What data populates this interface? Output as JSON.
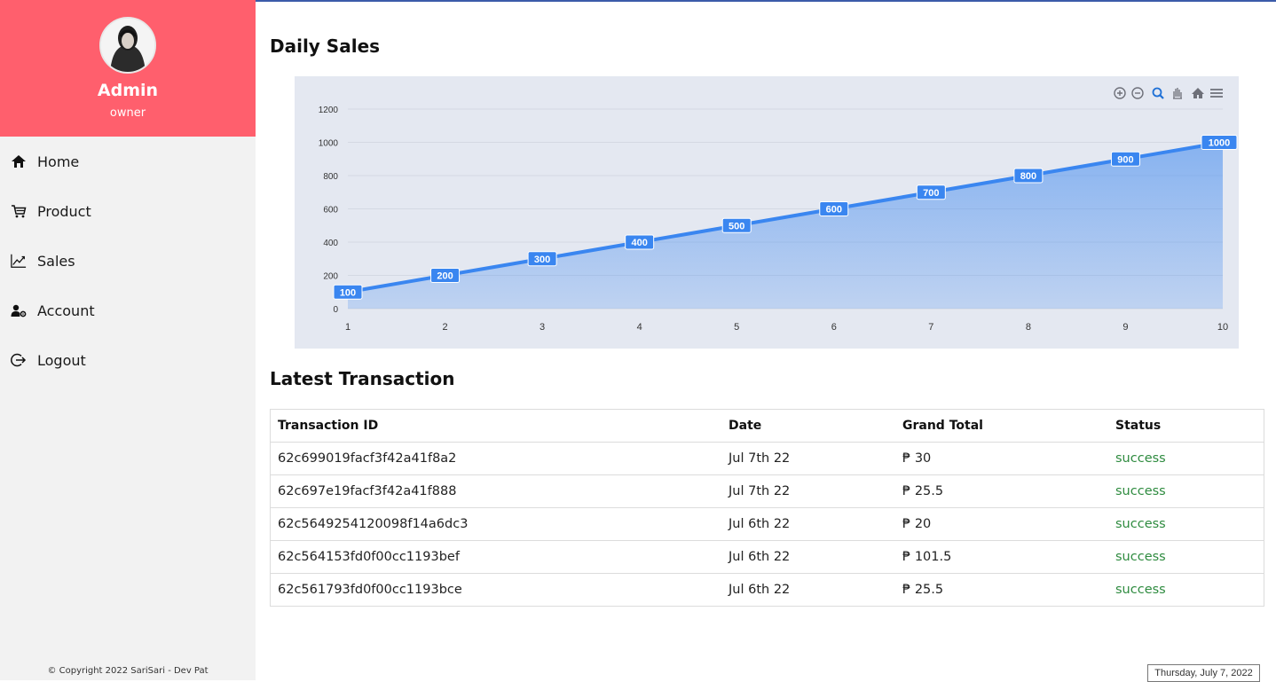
{
  "user": {
    "name": "Admin",
    "role": "owner"
  },
  "nav": [
    {
      "label": "Home",
      "icon": "home-icon"
    },
    {
      "label": "Product",
      "icon": "cart-icon"
    },
    {
      "label": "Sales",
      "icon": "chart-line-icon"
    },
    {
      "label": "Account",
      "icon": "user-gear-icon"
    },
    {
      "label": "Logout",
      "icon": "logout-icon"
    }
  ],
  "footer": {
    "copyright": "© Copyright 2022 SariSari - Dev Pat"
  },
  "daily_sales": {
    "title": "Daily Sales"
  },
  "chart_data": {
    "type": "area",
    "title": "",
    "xlabel": "",
    "ylabel": "",
    "x": [
      1,
      2,
      3,
      4,
      5,
      6,
      7,
      8,
      9,
      10
    ],
    "series": [
      {
        "values": [
          100,
          200,
          300,
          400,
          500,
          600,
          700,
          800,
          900,
          1000
        ]
      }
    ],
    "yticks": [
      0,
      200,
      400,
      600,
      800,
      1000,
      1200
    ],
    "ylim": [
      0,
      1200
    ],
    "grid": true,
    "data_labels": true,
    "color": "#3a86f0",
    "toolbar": [
      "zoom-in-icon",
      "zoom-out-icon",
      "selection-zoom-icon",
      "pan-icon",
      "reset-home-icon",
      "menu-icon"
    ]
  },
  "transactions": {
    "title": "Latest Transaction",
    "columns": [
      "Transaction ID",
      "Date",
      "Grand Total",
      "Status"
    ],
    "rows": [
      [
        "62c699019facf3f42a41f8a2",
        "Jul 7th 22",
        "₱ 30",
        "success"
      ],
      [
        "62c697e19facf3f42a41f888",
        "Jul 7th 22",
        "₱ 25.5",
        "success"
      ],
      [
        "62c5649254120098f14a6dc3",
        "Jul 6th 22",
        "₱ 20",
        "success"
      ],
      [
        "62c564153fd0f00cc1193bef",
        "Jul 6th 22",
        "₱ 101.5",
        "success"
      ],
      [
        "62c561793fd0f00cc1193bce",
        "Jul 6th 22",
        "₱ 25.5",
        "success"
      ]
    ]
  },
  "date_badge": "Thursday, July 7, 2022",
  "colors": {
    "sidebar_header": "#ff5f6d",
    "sidebar": "#f2f2f2",
    "status_success": "#2e8b3f",
    "chart_bg": "#e4e8f1"
  }
}
